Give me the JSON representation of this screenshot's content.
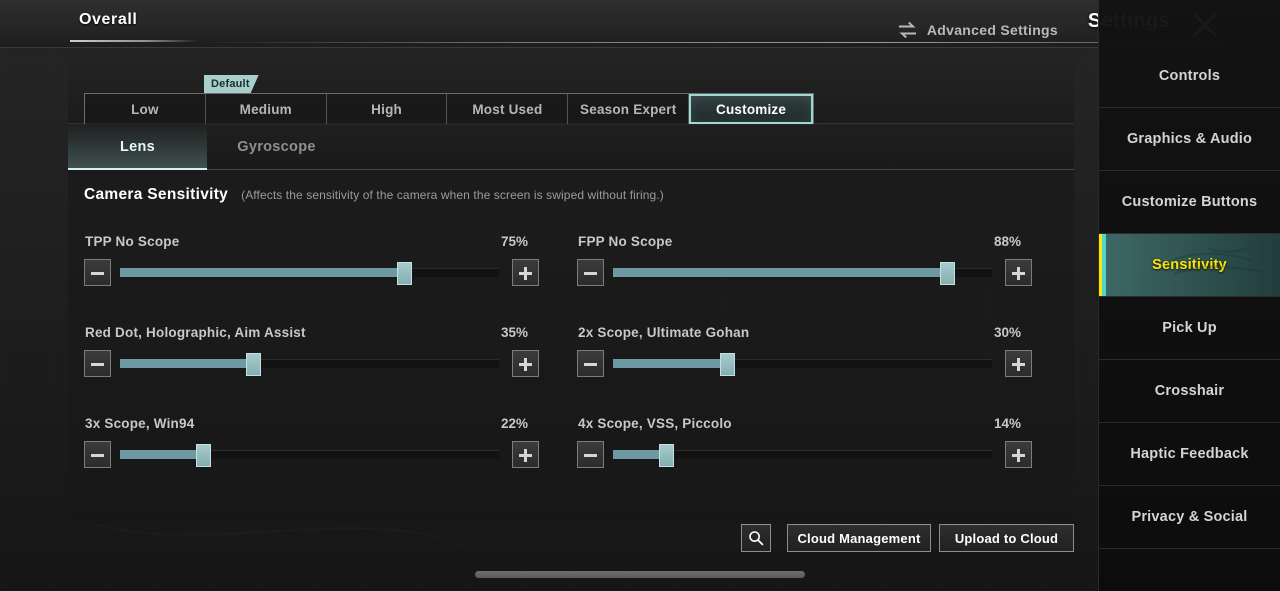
{
  "topbar": {
    "overall_tab": "Overall",
    "advanced_settings": "Advanced Settings",
    "advanced_settings_icon": "swap-arrows-icon",
    "title": "Settings",
    "close_icon": "close-icon"
  },
  "presets": {
    "default_tag": "Default",
    "items": [
      {
        "label": "Low",
        "selected": false
      },
      {
        "label": "Medium",
        "selected": false
      },
      {
        "label": "High",
        "selected": false
      },
      {
        "label": "Most Used",
        "selected": false
      },
      {
        "label": "Season Expert",
        "selected": false
      },
      {
        "label": "Customize",
        "selected": true
      }
    ]
  },
  "tabs": [
    {
      "label": "Lens",
      "active": true
    },
    {
      "label": "Gyroscope",
      "active": false
    }
  ],
  "section": {
    "title": "Camera Sensitivity",
    "description": "(Affects the sensitivity of the camera when the screen is swiped without firing.)"
  },
  "sliders": [
    {
      "label": "TPP No Scope",
      "value": "75%",
      "percent": 75
    },
    {
      "label": "FPP No Scope",
      "value": "88%",
      "percent": 88
    },
    {
      "label": "Red Dot, Holographic, Aim Assist",
      "value": "35%",
      "percent": 35
    },
    {
      "label": "2x Scope, Ultimate Gohan",
      "value": "30%",
      "percent": 30
    },
    {
      "label": "3x Scope, Win94",
      "value": "22%",
      "percent": 22
    },
    {
      "label": "4x Scope, VSS, Piccolo",
      "value": "14%",
      "percent": 14
    }
  ],
  "actions": {
    "search_icon": "search-icon",
    "cloud_management": "Cloud Management",
    "upload_to_cloud": "Upload to Cloud"
  },
  "sidebar": {
    "items": [
      {
        "label": "Controls",
        "selected": false
      },
      {
        "label": "Graphics & Audio",
        "selected": false
      },
      {
        "label": "Customize Buttons",
        "selected": false
      },
      {
        "label": "Sensitivity",
        "selected": true
      },
      {
        "label": "Pick Up",
        "selected": false
      },
      {
        "label": "Crosshair",
        "selected": false
      },
      {
        "label": "Haptic Feedback",
        "selected": false
      },
      {
        "label": "Privacy & Social",
        "selected": false
      }
    ]
  },
  "colors": {
    "accent_teal": "#9fd8d2",
    "selected_yellow": "#ffe600",
    "slider_fill": "#6d9aa2",
    "default_tag_bg": "#a8cfc9"
  }
}
